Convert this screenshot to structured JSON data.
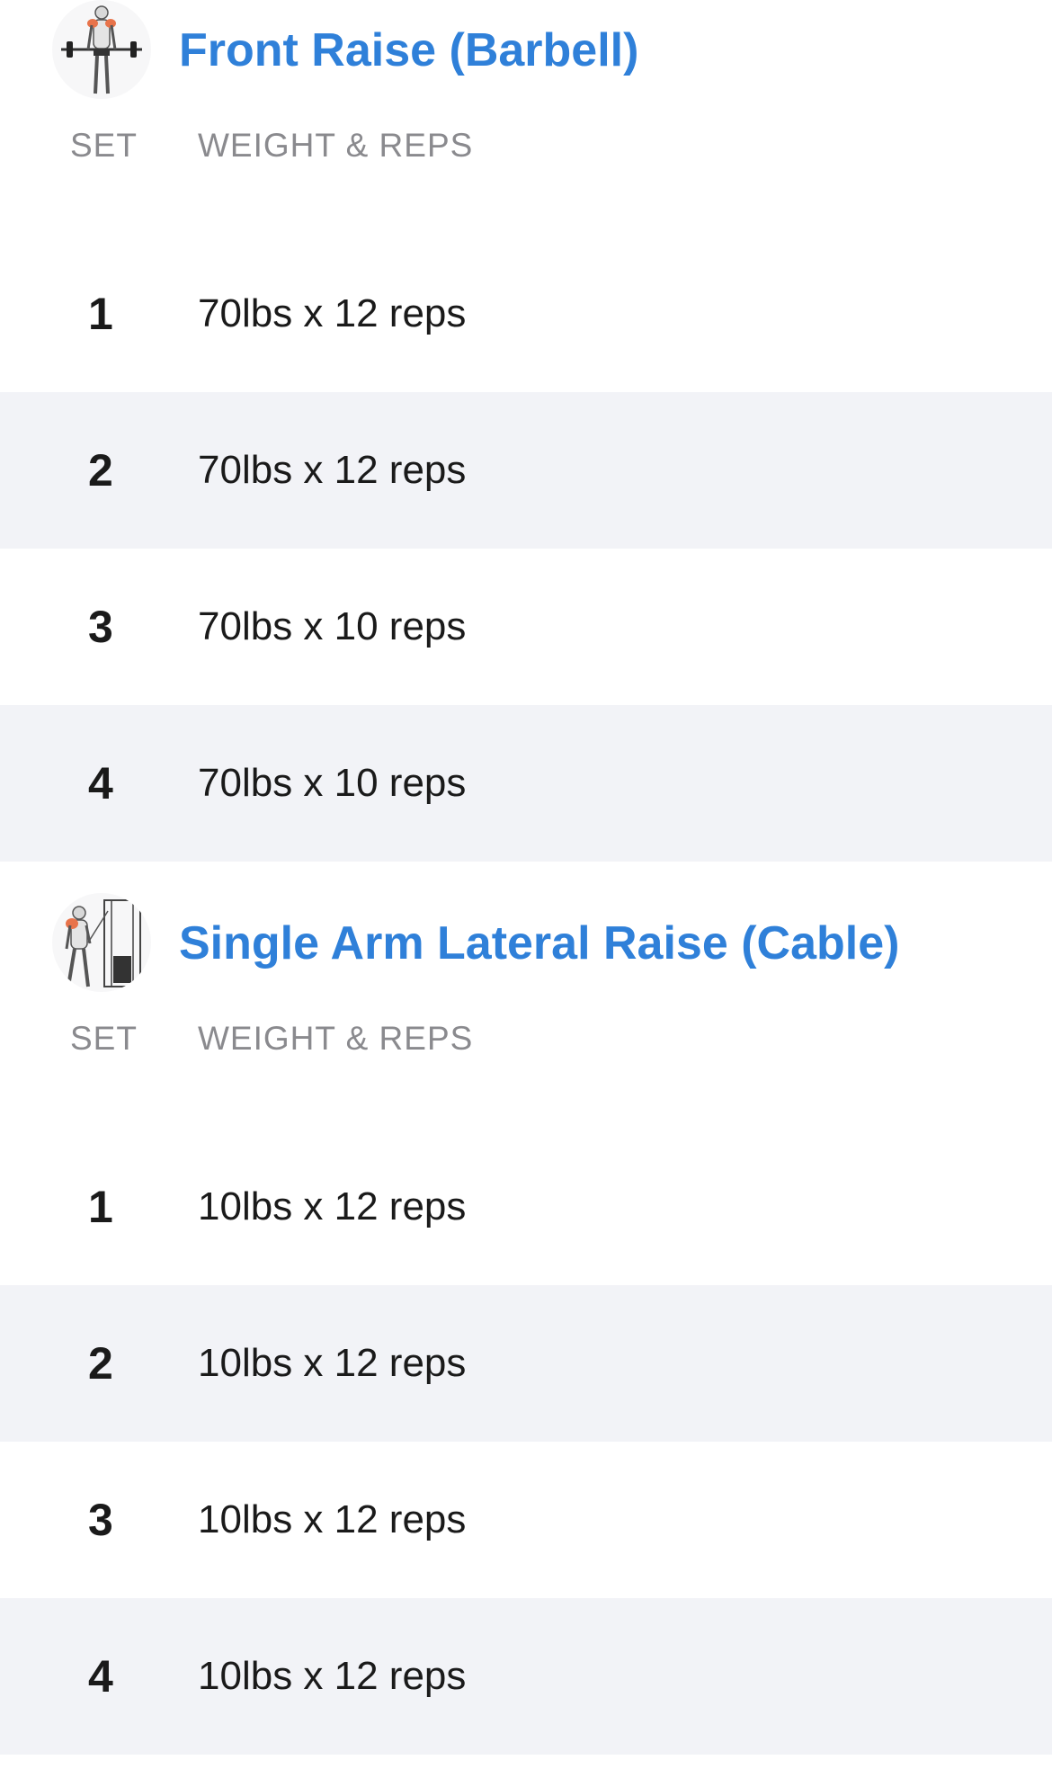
{
  "exercises": [
    {
      "title": "Front Raise (Barbell)",
      "thumbnail_icon": "barbell-front-raise-figure",
      "set_header": "SET",
      "weight_reps_header": "WEIGHT & REPS",
      "sets": [
        {
          "set": "1",
          "value": "70lbs x 12 reps"
        },
        {
          "set": "2",
          "value": "70lbs x 12 reps"
        },
        {
          "set": "3",
          "value": "70lbs x 10 reps"
        },
        {
          "set": "4",
          "value": "70lbs x 10 reps"
        }
      ]
    },
    {
      "title": "Single Arm Lateral Raise (Cable)",
      "thumbnail_icon": "cable-lateral-raise-figure",
      "set_header": "SET",
      "weight_reps_header": "WEIGHT & REPS",
      "sets": [
        {
          "set": "1",
          "value": "10lbs x 12 reps"
        },
        {
          "set": "2",
          "value": "10lbs x 12 reps"
        },
        {
          "set": "3",
          "value": "10lbs x 12 reps"
        },
        {
          "set": "4",
          "value": "10lbs x 12 reps"
        }
      ]
    }
  ],
  "colors": {
    "title": "#2f80d9",
    "header_text": "#8a8a8e",
    "alt_row": "#f2f3f7",
    "muscle_highlight": "#e8734a"
  }
}
